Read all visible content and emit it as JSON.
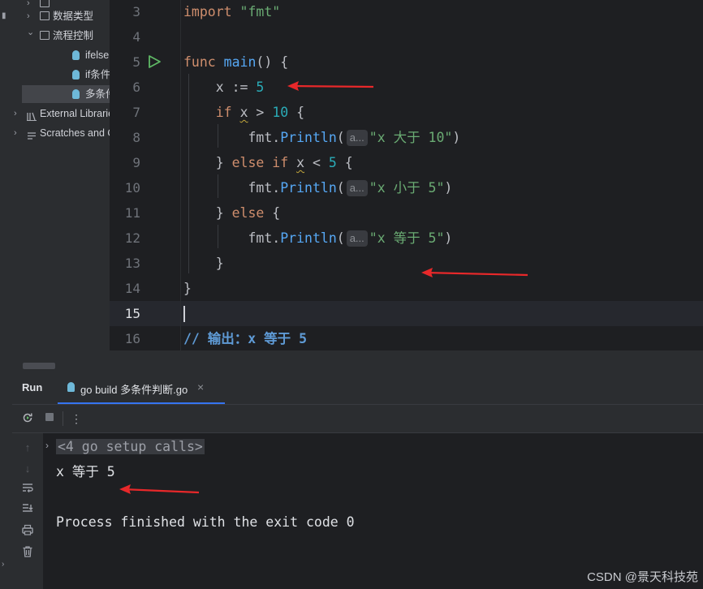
{
  "project_tree": {
    "items": [
      {
        "label": "",
        "kind": "folder",
        "indent": 1
      },
      {
        "label": "数据类型",
        "kind": "folder",
        "indent": 1
      },
      {
        "label": "流程控制",
        "kind": "folder",
        "indent": 1,
        "expanded": true
      },
      {
        "label": "ifelse",
        "kind": "gofile",
        "indent": 2
      },
      {
        "label": "if条件",
        "kind": "gofile",
        "indent": 2
      },
      {
        "label": "多条件",
        "kind": "gofile",
        "indent": 2,
        "selected": true
      },
      {
        "label": "External Libraries",
        "kind": "library",
        "indent": 0
      },
      {
        "label": "Scratches and Consoles",
        "kind": "scratches",
        "indent": 0
      }
    ]
  },
  "editor": {
    "lines": [
      {
        "no": "3",
        "tokens": [
          [
            "kw",
            "import "
          ],
          [
            "str",
            "\"fmt\""
          ]
        ]
      },
      {
        "no": "4",
        "tokens": []
      },
      {
        "no": "5",
        "tokens": [
          [
            "kw",
            "func "
          ],
          [
            "fn",
            "main"
          ],
          [
            "pkg",
            "() {"
          ]
        ],
        "run_icon": true
      },
      {
        "no": "6",
        "tokens": [
          [
            "pkg",
            "    x := "
          ],
          [
            "num",
            "5"
          ]
        ]
      },
      {
        "no": "7",
        "tokens": [
          [
            "pkg",
            "    "
          ],
          [
            "kw",
            "if "
          ],
          [
            "sq",
            "x"
          ],
          [
            "pkg",
            " > "
          ],
          [
            "num",
            "10"
          ],
          [
            "pkg",
            " {"
          ]
        ]
      },
      {
        "no": "8",
        "tokens": [
          [
            "pkg",
            "        fmt."
          ],
          [
            "fn",
            "Println"
          ],
          [
            "pkg",
            "("
          ],
          [
            "hint",
            "a..."
          ],
          [
            "str",
            "\"x 大于 10\""
          ],
          [
            "pkg",
            ")"
          ]
        ]
      },
      {
        "no": "9",
        "tokens": [
          [
            "pkg",
            "    } "
          ],
          [
            "kw",
            "else if "
          ],
          [
            "sq",
            "x"
          ],
          [
            "pkg",
            " < "
          ],
          [
            "num",
            "5"
          ],
          [
            "pkg",
            " {"
          ]
        ]
      },
      {
        "no": "10",
        "tokens": [
          [
            "pkg",
            "        fmt."
          ],
          [
            "fn",
            "Println"
          ],
          [
            "pkg",
            "("
          ],
          [
            "hint",
            "a..."
          ],
          [
            "str",
            "\"x 小于 5\""
          ],
          [
            "pkg",
            ")"
          ]
        ]
      },
      {
        "no": "11",
        "tokens": [
          [
            "pkg",
            "    } "
          ],
          [
            "kw",
            "else "
          ],
          [
            "pkg",
            "{"
          ]
        ]
      },
      {
        "no": "12",
        "tokens": [
          [
            "pkg",
            "        fmt."
          ],
          [
            "fn",
            "Println"
          ],
          [
            "pkg",
            "("
          ],
          [
            "hint",
            "a..."
          ],
          [
            "str",
            "\"x 等于 5\""
          ],
          [
            "pkg",
            ")"
          ]
        ]
      },
      {
        "no": "13",
        "tokens": [
          [
            "pkg",
            "    }"
          ]
        ]
      },
      {
        "no": "14",
        "tokens": [
          [
            "pkg",
            "}"
          ]
        ]
      },
      {
        "no": "15",
        "tokens": [],
        "current": true
      },
      {
        "no": "16",
        "tokens": [
          [
            "cmt",
            "// 输出：x 等于 5"
          ]
        ]
      }
    ]
  },
  "run_panel": {
    "title": "Run",
    "tab_label": "go build 多条件判断.go",
    "close_glyph": "×",
    "console": {
      "folded_label": "<4 go setup calls>",
      "output": "x 等于 5",
      "exit_message": "Process finished with the exit code 0"
    }
  },
  "icons": {
    "rerun": "rerun-icon",
    "stop": "stop-icon",
    "more": "more-icon",
    "up": "arrow-up-icon",
    "down": "arrow-down-icon",
    "wrap": "soft-wrap-icon",
    "scroll_end": "scroll-to-end-icon",
    "print": "print-icon",
    "trash": "trash-icon"
  },
  "watermark": "CSDN @景天科技苑",
  "colors": {
    "accent": "#3574f0",
    "annotation_arrow": "#e8282a",
    "run_icon": "#5fb865"
  }
}
